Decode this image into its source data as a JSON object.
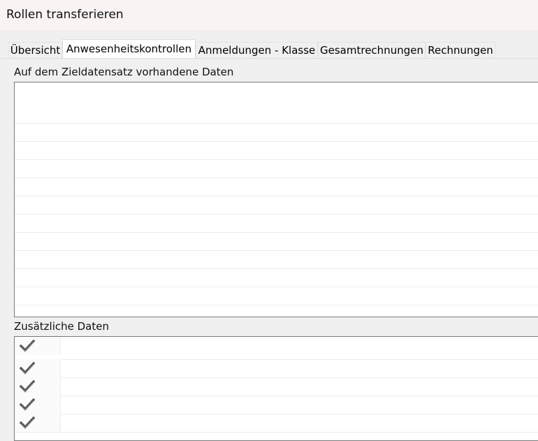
{
  "window": {
    "title": "Rollen transferieren"
  },
  "tabs": [
    {
      "label": "Übersicht",
      "active": false
    },
    {
      "label": "Anwesenheitskontrollen",
      "active": true
    },
    {
      "label": "Anmeldungen - Klasse",
      "active": false
    },
    {
      "label": "Gesamtrechnungen",
      "active": false
    },
    {
      "label": "Rechnungen",
      "active": false
    }
  ],
  "target_section": {
    "label": "Auf dem Zieldatensatz vorhandene Daten"
  },
  "additional_section": {
    "label": "Zusätzliche Daten",
    "rows": [
      {
        "checked": true
      },
      {
        "checked": true
      },
      {
        "checked": true
      },
      {
        "checked": true
      },
      {
        "checked": true
      }
    ]
  },
  "icons": {
    "checkbox": "checkmark-icon"
  },
  "colors": {
    "checkmark": "#5a5a5a",
    "grid_border": "#7a7a7a"
  }
}
